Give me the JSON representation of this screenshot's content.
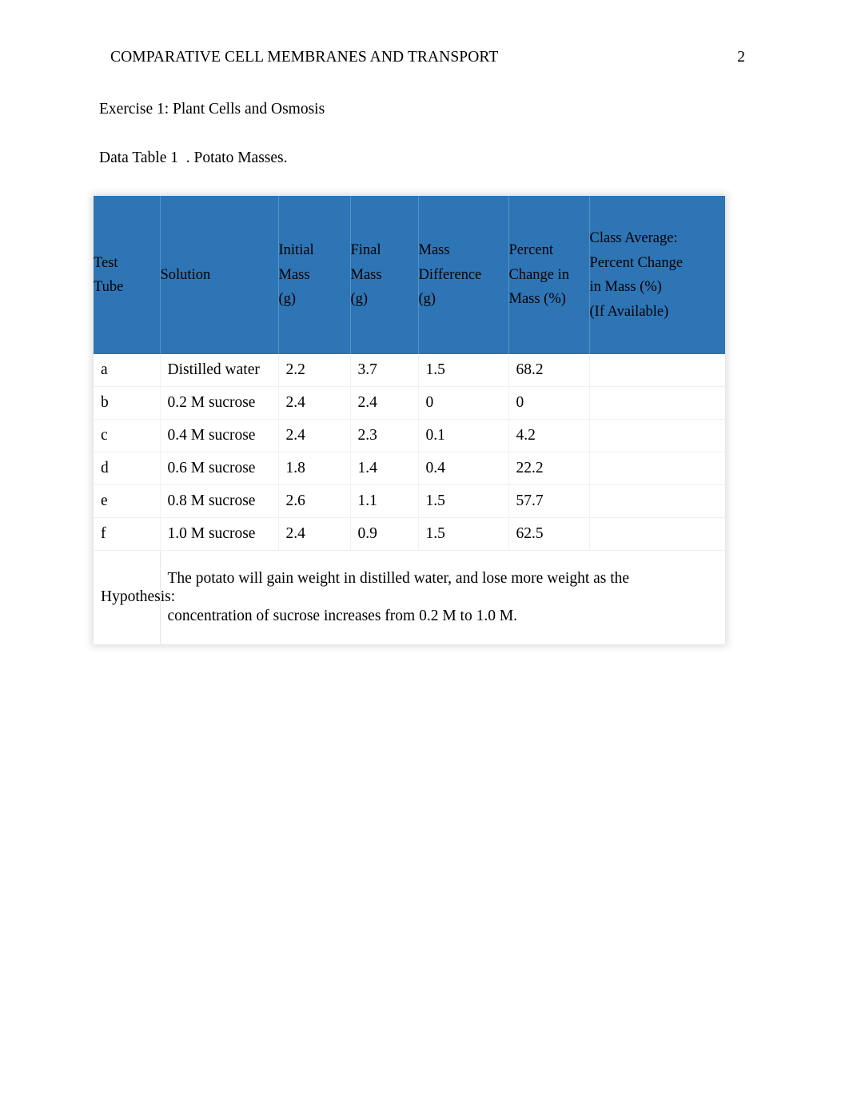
{
  "header": {
    "title": "COMPARATIVE CELL MEMBRANES AND TRANSPORT",
    "page_number": "2"
  },
  "body": {
    "exercise_heading": "Exercise 1: Plant Cells and Osmosis",
    "table_caption": "Data Table 1  . Potato Masses."
  },
  "colors": {
    "table_header_bg": "#2E75B6",
    "table_header_text": "#000000",
    "row_divider": "#efefef",
    "page_bg": "#ffffff"
  },
  "table": {
    "columns": [
      {
        "key": "tube",
        "lines": [
          "Test",
          "Tube"
        ]
      },
      {
        "key": "solution",
        "lines": [
          "Solution"
        ]
      },
      {
        "key": "initial_mass",
        "lines": [
          "Initial",
          "Mass",
          "(g)"
        ]
      },
      {
        "key": "final_mass",
        "lines": [
          "Final",
          "Mass",
          "(g)"
        ]
      },
      {
        "key": "mass_diff",
        "lines": [
          "Mass",
          "Difference",
          "(g)"
        ]
      },
      {
        "key": "percent_change",
        "lines": [
          "Percent",
          "Change in",
          "Mass (%)"
        ]
      },
      {
        "key": "class_average",
        "lines": [
          "Class Average:",
          "Percent Change",
          "in Mass (%)",
          "(If Available)"
        ]
      }
    ],
    "rows": [
      {
        "tube": "a",
        "solution": "Distilled water",
        "initial_mass": "2.2",
        "final_mass": "3.7",
        "mass_diff": "1.5",
        "percent_change": "68.2",
        "class_average": ""
      },
      {
        "tube": "b",
        "solution": "0.2 M sucrose",
        "initial_mass": "2.4",
        "final_mass": "2.4",
        "mass_diff": "0",
        "percent_change": "0",
        "class_average": ""
      },
      {
        "tube": "c",
        "solution": "0.4 M sucrose",
        "initial_mass": "2.4",
        "final_mass": "2.3",
        "mass_diff": "0.1",
        "percent_change": "4.2",
        "class_average": ""
      },
      {
        "tube": "d",
        "solution": "0.6 M sucrose",
        "initial_mass": "1.8",
        "final_mass": "1.4",
        "mass_diff": "0.4",
        "percent_change": "22.2",
        "class_average": ""
      },
      {
        "tube": "e",
        "solution": "0.8 M sucrose",
        "initial_mass": "2.6",
        "final_mass": "1.1",
        "mass_diff": "1.5",
        "percent_change": "57.7",
        "class_average": ""
      },
      {
        "tube": "f",
        "solution": "1.0 M sucrose",
        "initial_mass": "2.4",
        "final_mass": "0.9",
        "mass_diff": "1.5",
        "percent_change": "62.5",
        "class_average": ""
      }
    ],
    "hypothesis": {
      "label": "Hypothesis:",
      "line1": "The potato will gain weight in distilled water, and lose more weight as the",
      "line2": "concentration of sucrose increases from 0.2 M to 1.0 M."
    }
  }
}
